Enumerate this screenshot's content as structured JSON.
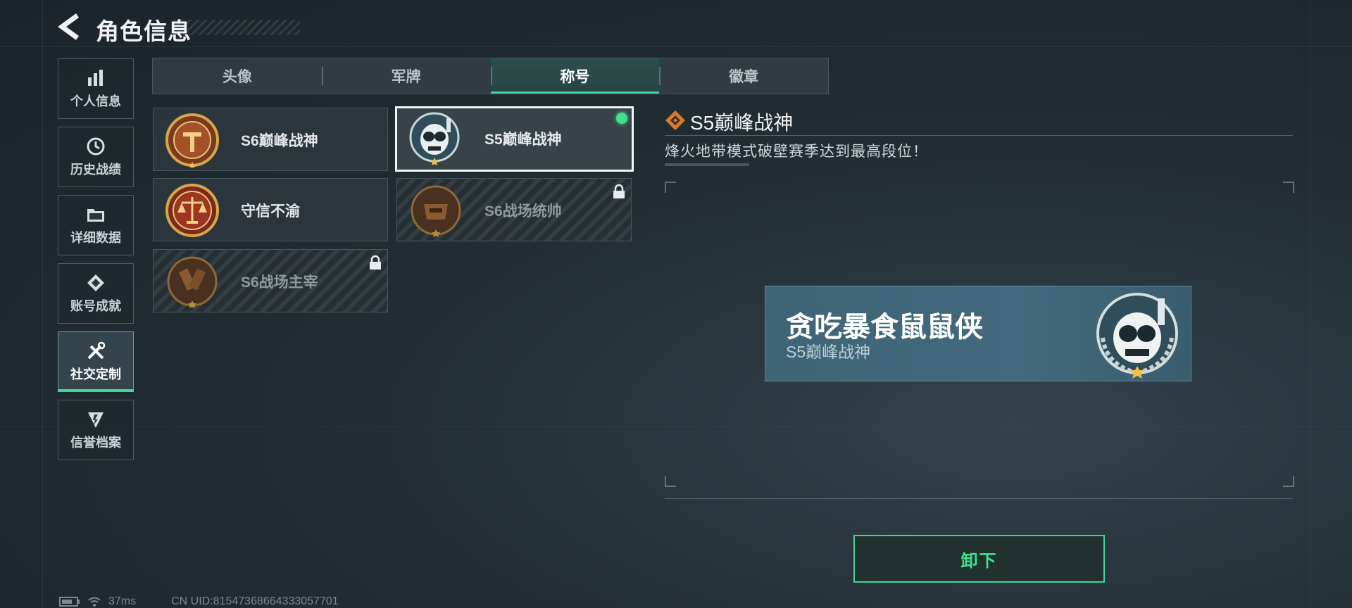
{
  "header": {
    "title": "角色信息"
  },
  "sidebar": {
    "items": [
      {
        "label": "个人信息",
        "icon": "bar-chart-icon"
      },
      {
        "label": "历史战绩",
        "icon": "history-clock-icon"
      },
      {
        "label": "详细数据",
        "icon": "folder-icon"
      },
      {
        "label": "账号成就",
        "icon": "achievement-icon"
      },
      {
        "label": "社交定制",
        "icon": "tools-icon",
        "active": true
      },
      {
        "label": "信誉档案",
        "icon": "credit-shield-icon"
      }
    ]
  },
  "tabs": [
    {
      "label": "头像"
    },
    {
      "label": "军牌"
    },
    {
      "label": "称号",
      "active": true
    },
    {
      "label": "徽章"
    }
  ],
  "titles": [
    {
      "name": "S6巅峰战神",
      "locked": false,
      "selected": false
    },
    {
      "name": "S5巅峰战神",
      "locked": false,
      "selected": true,
      "equipped": true
    },
    {
      "name": "守信不渝",
      "locked": false,
      "selected": false
    },
    {
      "name": "S6战场统帅",
      "locked": true,
      "selected": false
    },
    {
      "name": "S6战场主宰",
      "locked": true,
      "selected": false
    }
  ],
  "detail": {
    "title": "S5巅峰战神",
    "description": "烽火地带模式破壁赛季达到最高段位！"
  },
  "nameplate": {
    "player_name": "贪吃暴食鼠鼠侠",
    "title": "S5巅峰战神"
  },
  "action": {
    "unequip_label": "卸下"
  },
  "status_bar": {
    "ping": "37ms",
    "uid": "CN UID:815473686643330577​01"
  },
  "colors": {
    "accent": "#3fd49a",
    "equipped_dot": "#3fe08e"
  }
}
